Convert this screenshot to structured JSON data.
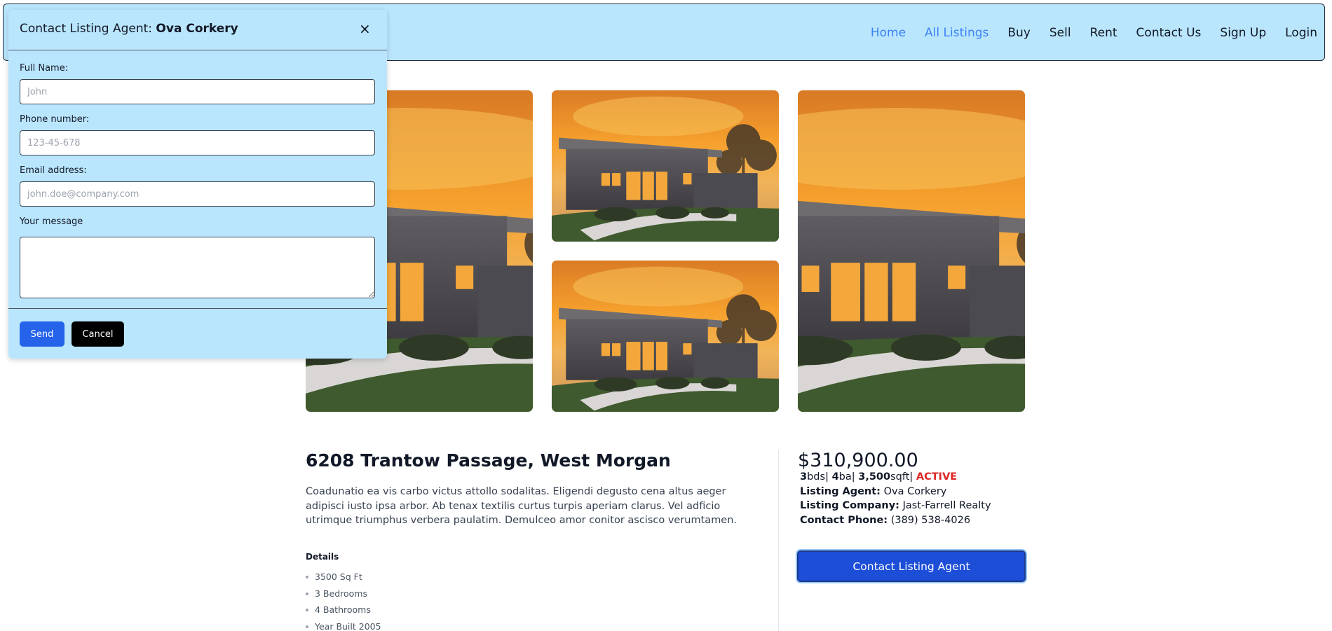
{
  "nav": {
    "items": [
      {
        "label": "Home",
        "active": true
      },
      {
        "label": "All Listings",
        "active": true
      },
      {
        "label": "Buy",
        "active": false
      },
      {
        "label": "Sell",
        "active": false
      },
      {
        "label": "Rent",
        "active": false
      },
      {
        "label": "Contact Us",
        "active": false
      },
      {
        "label": "Sign Up",
        "active": false
      },
      {
        "label": "Login",
        "active": false
      }
    ]
  },
  "listing": {
    "address": "6208 Trantow Passage, West Morgan",
    "description": "Coadunatio ea vis carbo victus attollo sodalitas. Eligendi degusto cena altus aeger adipisci iusto ipsa arbor. Ab tenax textilis curtus turpis aperiam clarus. Vel adficio utrimque triumphus verbera paulatim. Demulceo amor conitor ascisco verumtamen.",
    "details_heading": "Details",
    "details": [
      "3500 Sq Ft",
      "3 Bedrooms",
      "4 Bathrooms",
      "Year Built 2005"
    ],
    "price": "$310,900.00",
    "beds": "3",
    "beds_unit": "bds",
    "baths": "4",
    "baths_unit": "ba",
    "sqft": "3,500",
    "sqft_unit": "sqft",
    "status": "ACTIVE",
    "agent_label": "Listing Agent:",
    "agent": "Ova Corkery",
    "company_label": "Listing Company:",
    "company": "Jast-Farrell Realty",
    "phone_label": "Contact Phone:",
    "phone": "(389) 538-4026",
    "contact_button": "Contact Listing Agent"
  },
  "modal": {
    "title_prefix": "Contact Listing Agent:",
    "agent_name": "Ova Corkery",
    "close": "×",
    "full_name_label": "Full Name:",
    "full_name_placeholder": "John",
    "phone_label": "Phone number:",
    "phone_placeholder": "123-45-678",
    "email_label": "Email address:",
    "email_placeholder": "john.doe@company.com",
    "message_label": "Your message",
    "send": "Send",
    "cancel": "Cancel"
  },
  "colors": {
    "header_bg": "#bae6fd",
    "nav_active": "#3b82f6",
    "status": "#dc2626",
    "primary_button": "#1d4ed8",
    "send_button": "#2563eb",
    "cancel_button": "#000000"
  }
}
